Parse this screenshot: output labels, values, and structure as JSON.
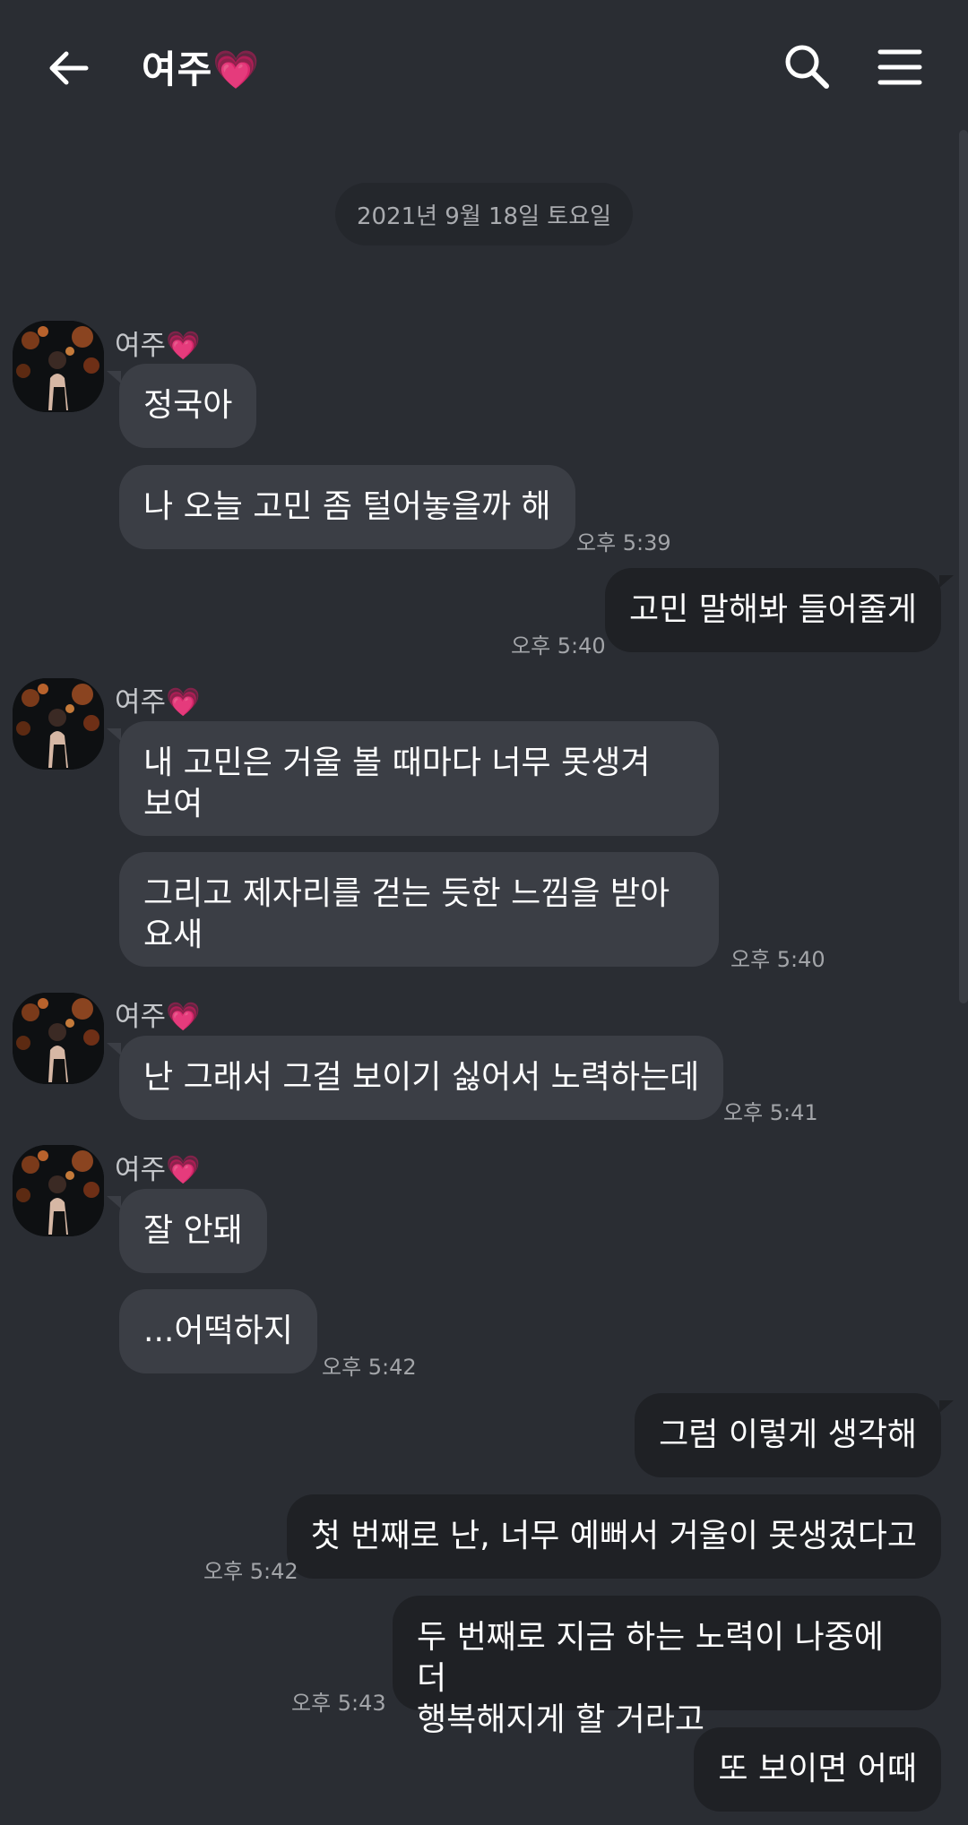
{
  "header": {
    "title": "여주💗"
  },
  "date_divider": "2021년 9월 18일 토요일",
  "messages": [
    {
      "sender": "여주💗",
      "text": "정국아"
    },
    {
      "text": "나 오늘 고민 좀 털어놓을까 해",
      "time": "오후 5:39"
    },
    {
      "text": "고민 말해봐 들어줄게",
      "time": "오후 5:40"
    },
    {
      "sender": "여주💗",
      "text": "내 고민은 거울 볼 때마다 너무 못생겨\n보여"
    },
    {
      "text": "그리고 제자리를 걷는 듯한 느낌을 받아\n요새",
      "time": "오후 5:40"
    },
    {
      "sender": "여주💗",
      "text": "난 그래서 그걸 보이기 싫어서 노력하는데",
      "time": "오후 5:41"
    },
    {
      "sender": "여주💗",
      "text": "잘 안돼"
    },
    {
      "text": "...어떡하지",
      "time": "오후 5:42"
    },
    {
      "text": "그럼 이렇게 생각해"
    },
    {
      "text": "첫 번째로 난, 너무 예뻐서 거울이 못생겼다고",
      "time": "오후 5:42"
    },
    {
      "text": "두 번째로 지금 하는 노력이 나중에 더\n행복해지게 할 거라고",
      "time": "오후 5:43"
    },
    {
      "text": "또 보이면 어때"
    }
  ]
}
